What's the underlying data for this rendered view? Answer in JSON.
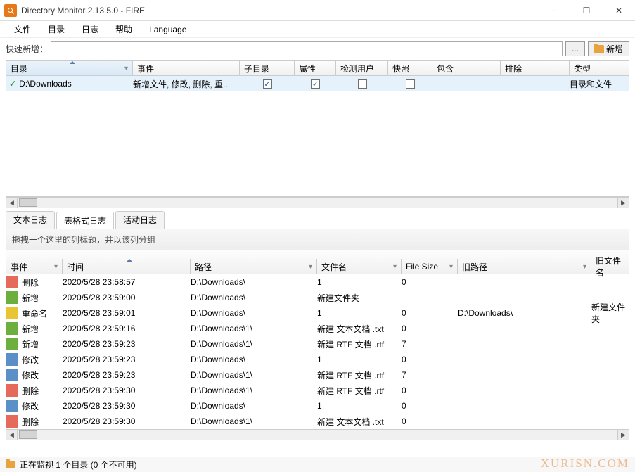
{
  "window": {
    "title": "Directory Monitor 2.13.5.0 - FIRE"
  },
  "menu": {
    "file": "文件",
    "dir": "目录",
    "log": "日志",
    "help": "帮助",
    "lang": "Language"
  },
  "quickadd": {
    "label": "快速新增：",
    "placeholder": "",
    "browse": "...",
    "add": "新增"
  },
  "top_cols": {
    "dir": "目录",
    "event": "事件",
    "subdir": "子目录",
    "attr": "属性",
    "detect": "检测用户",
    "snapshot": "快照",
    "include": "包含",
    "exclude": "排除",
    "type": "类型"
  },
  "top_row": {
    "path": "D:\\Downloads",
    "events": "新增文件, 修改, 删除, 重..",
    "subdir": true,
    "attr": true,
    "detect": false,
    "snapshot": false,
    "type": "目录和文件"
  },
  "tabs": {
    "text": "文本日志",
    "table": "表格式日志",
    "activity": "活动日志"
  },
  "group_hint": "拖拽一个这里的列标题，并以该列分组",
  "log_cols": {
    "event": "事件",
    "time": "时间",
    "path": "路径",
    "filename": "文件名",
    "filesize": "File Size",
    "oldpath": "旧路径",
    "oldfile": "旧文件名"
  },
  "log_rows": [
    {
      "c": "c-red",
      "event": "删除",
      "time": "2020/5/28 23:58:57",
      "path": "D:\\Downloads\\",
      "file": "1",
      "size": "0",
      "old": "",
      "oldfile": ""
    },
    {
      "c": "c-green",
      "event": "新增",
      "time": "2020/5/28 23:59:00",
      "path": "D:\\Downloads\\",
      "file": "新建文件夹",
      "size": "",
      "old": "",
      "oldfile": ""
    },
    {
      "c": "c-yellow",
      "event": "重命名",
      "time": "2020/5/28 23:59:01",
      "path": "D:\\Downloads\\",
      "file": "1",
      "size": "0",
      "old": "D:\\Downloads\\",
      "oldfile": "新建文件夹"
    },
    {
      "c": "c-green",
      "event": "新增",
      "time": "2020/5/28 23:59:16",
      "path": "D:\\Downloads\\1\\",
      "file": "新建 文本文档 .txt",
      "size": "0",
      "old": "",
      "oldfile": ""
    },
    {
      "c": "c-green",
      "event": "新增",
      "time": "2020/5/28 23:59:23",
      "path": "D:\\Downloads\\1\\",
      "file": "新建 RTF 文档 .rtf",
      "size": "7",
      "old": "",
      "oldfile": ""
    },
    {
      "c": "c-blue",
      "event": "修改",
      "time": "2020/5/28 23:59:23",
      "path": "D:\\Downloads\\",
      "file": "1",
      "size": "0",
      "old": "",
      "oldfile": ""
    },
    {
      "c": "c-blue",
      "event": "修改",
      "time": "2020/5/28 23:59:23",
      "path": "D:\\Downloads\\1\\",
      "file": "新建 RTF 文档 .rtf",
      "size": "7",
      "old": "",
      "oldfile": ""
    },
    {
      "c": "c-red",
      "event": "删除",
      "time": "2020/5/28 23:59:30",
      "path": "D:\\Downloads\\1\\",
      "file": "新建 RTF 文档 .rtf",
      "size": "0",
      "old": "",
      "oldfile": ""
    },
    {
      "c": "c-blue",
      "event": "修改",
      "time": "2020/5/28 23:59:30",
      "path": "D:\\Downloads\\",
      "file": "1",
      "size": "0",
      "old": "",
      "oldfile": ""
    },
    {
      "c": "c-red",
      "event": "删除",
      "time": "2020/5/28 23:59:30",
      "path": "D:\\Downloads\\1\\",
      "file": "新建 文本文档 .txt",
      "size": "0",
      "old": "",
      "oldfile": ""
    }
  ],
  "status": "正在监视 1 个目录  (0 个不可用)",
  "watermark": "XURISN.COM"
}
